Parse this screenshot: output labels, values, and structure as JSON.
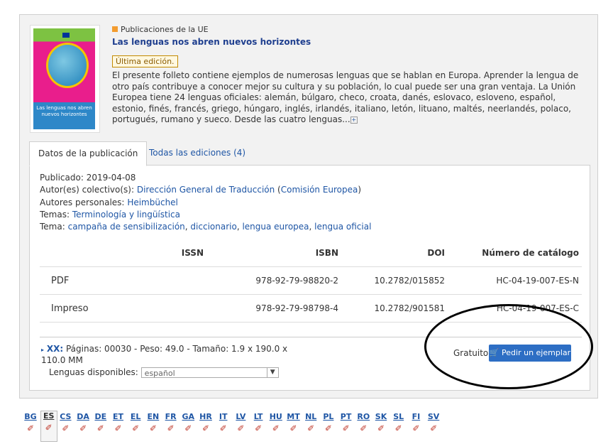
{
  "publication": {
    "source": "Publicaciones de la UE",
    "title": "Las lenguas nos abren nuevos horizontes",
    "badge": "Última edición.",
    "description": "El presente folleto contiene ejemplos de numerosas lenguas que se hablan en Europa. Aprender la lengua de otro país contribuye a conocer mejor su cultura y su población, lo cual puede ser una gran ventaja. La Unión Europea tiene 24 lenguas oficiales: alemán, búlgaro, checo, croata, danés, eslovaco, esloveno, español, estonio, finés, francés, griego, húngaro, inglés, irlandés, italiano, letón, lituano, maltés, neerlandés, polaco, portugués, rumano y sueco. Desde las cuatro lenguas...",
    "more_icon": "plus-icon",
    "cover_text": "Las lenguas nos abren nuevos horizontes"
  },
  "tabs": [
    {
      "label": "Datos de la publicación",
      "active": true
    },
    {
      "label": "Todas las ediciones (4)",
      "active": false
    }
  ],
  "details": {
    "published_label": "Publicado:",
    "published": "2019-04-08",
    "authors_label": "Autor(es) colectivo(s):",
    "author": "Dirección General de Traducción",
    "author_org": "Comisión Europea",
    "personal_label": "Autores personales:",
    "personal": "Heimbüchel",
    "themes_label": "Temas:",
    "themes": "Terminología y lingüística",
    "subject_label": "Tema:",
    "subjects": [
      "campaña de sensibilización",
      "diccionario",
      "lengua europea",
      "lengua oficial"
    ]
  },
  "formats_table": {
    "headers": [
      "",
      "ISSN",
      "ISBN",
      "DOI",
      "Número de catálogo"
    ],
    "rows": [
      {
        "format": "PDF",
        "issn": "",
        "isbn": "978-92-79-98820-2",
        "doi": "10.2782/015852",
        "catalog": "HC-04-19-007-ES-N"
      },
      {
        "format": "Impreso",
        "issn": "",
        "isbn": "978-92-79-98798-4",
        "doi": "10.2782/901581",
        "catalog": "HC-04-19-007-ES-C"
      }
    ]
  },
  "print_info": {
    "code": "XX:",
    "text": "Páginas: 00030 - Peso: 49.0 - Tamaño: 1.9 x 190.0 x 110.0 MM",
    "languages_label": "Lenguas disponibles:",
    "language_selected": "español",
    "price": "Gratuito",
    "order_label": "Pedir un ejemplar",
    "order_icon": "cart-icon"
  },
  "languages": [
    "BG",
    "ES",
    "CS",
    "DA",
    "DE",
    "ET",
    "EL",
    "EN",
    "FR",
    "GA",
    "HR",
    "IT",
    "LV",
    "LT",
    "HU",
    "MT",
    "NL",
    "PL",
    "PT",
    "RO",
    "SK",
    "SL",
    "FI",
    "SV"
  ],
  "active_language": "ES",
  "colors": {
    "link": "#1f56a5",
    "button": "#2d6ec4",
    "accent_orange": "#f39c2f"
  }
}
